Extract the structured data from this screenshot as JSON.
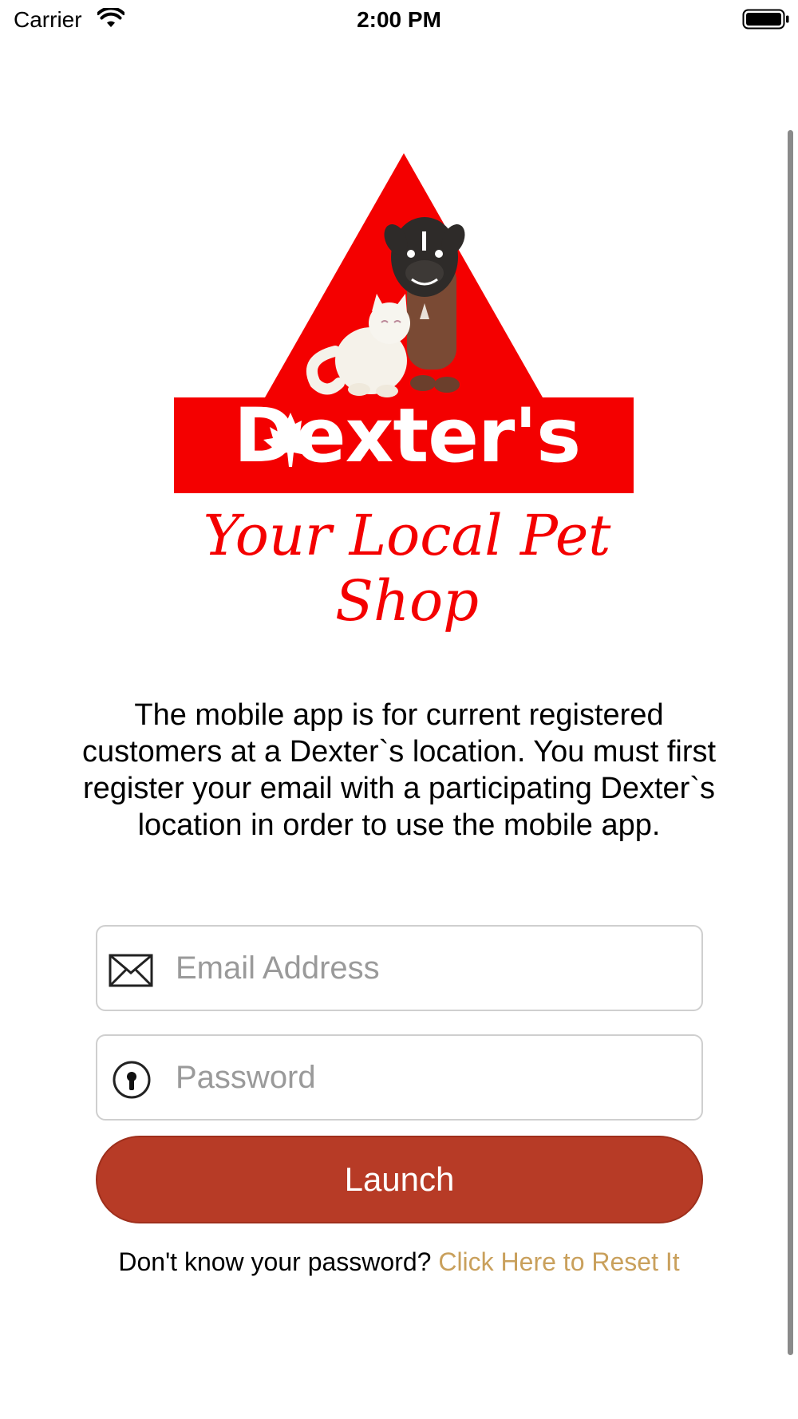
{
  "status_bar": {
    "carrier": "Carrier",
    "time": "2:00 PM"
  },
  "logo": {
    "brand": "Dexter's",
    "tagline": "Your Local Pet Shop",
    "accent_color": "#f40000"
  },
  "intro_text": "The mobile app is for current registered customers at a Dexter`s location. You must first register your email with a participating Dexter`s location in order to use the mobile app.",
  "email": {
    "placeholder": "Email Address",
    "value": "",
    "icon": "envelope-icon"
  },
  "password": {
    "placeholder": "Password",
    "value": "",
    "icon": "keyhole-icon"
  },
  "launch_label": "Launch",
  "reset": {
    "prompt": "Don't know your password?",
    "link": "Click Here to Reset It"
  }
}
